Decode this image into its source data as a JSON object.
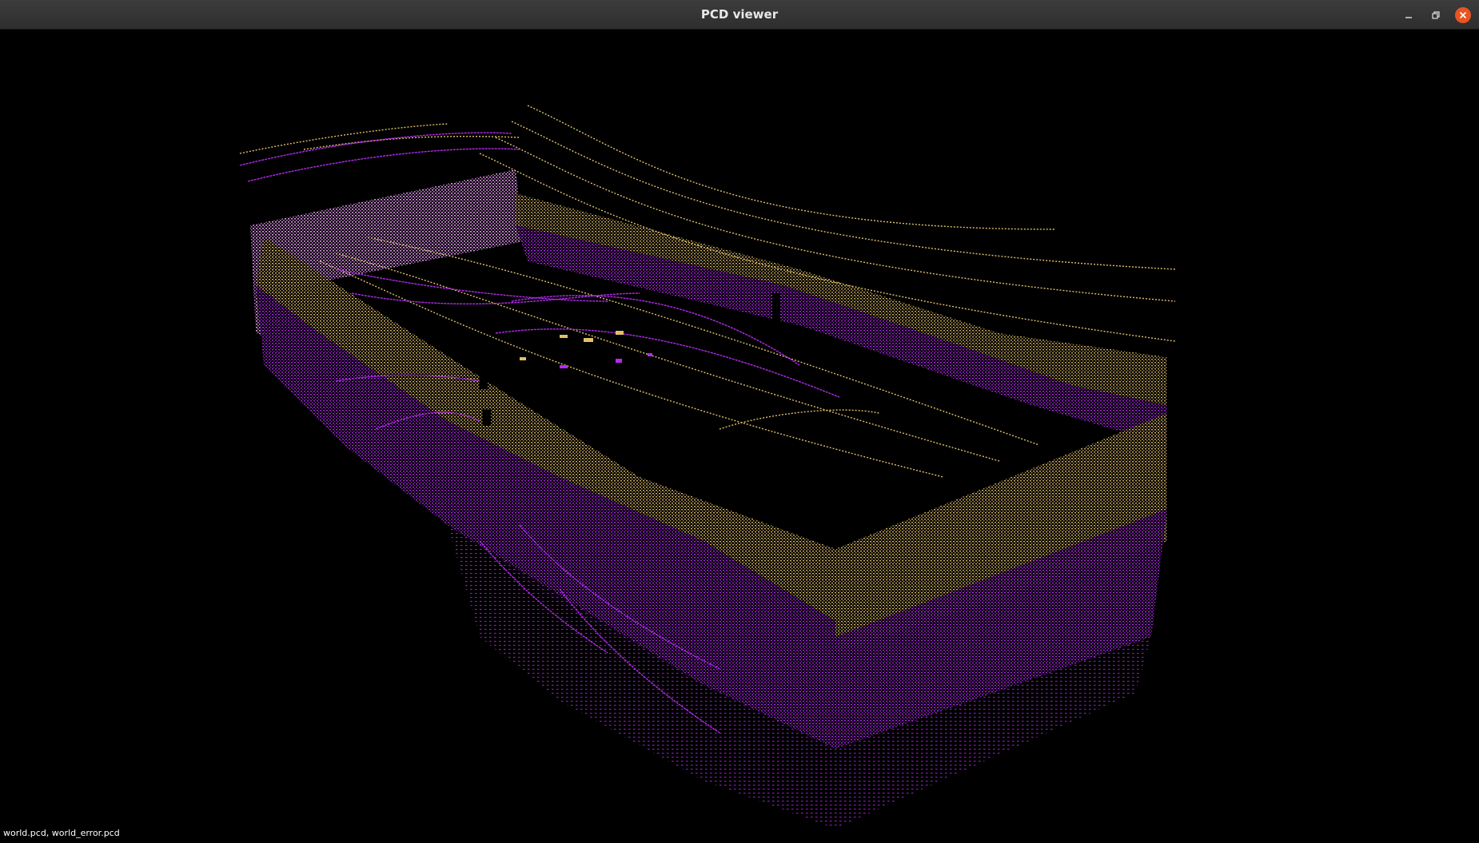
{
  "window": {
    "title": "PCD viewer",
    "controls": {
      "minimize_icon": "minimize-icon",
      "maximize_icon": "restore-icon",
      "close_icon": "close-icon"
    }
  },
  "viewport": {
    "background": "#000000",
    "clouds": [
      {
        "file": "world.pcd",
        "color": "#b32bef"
      },
      {
        "file": "world_error.pcd",
        "color": "#e0c06a"
      }
    ]
  },
  "status": {
    "loaded_files": "world.pcd, world_error.pcd"
  },
  "colors": {
    "titlebar": "#333333",
    "close_button": "#e95420",
    "title_text": "#e8e8e8"
  }
}
